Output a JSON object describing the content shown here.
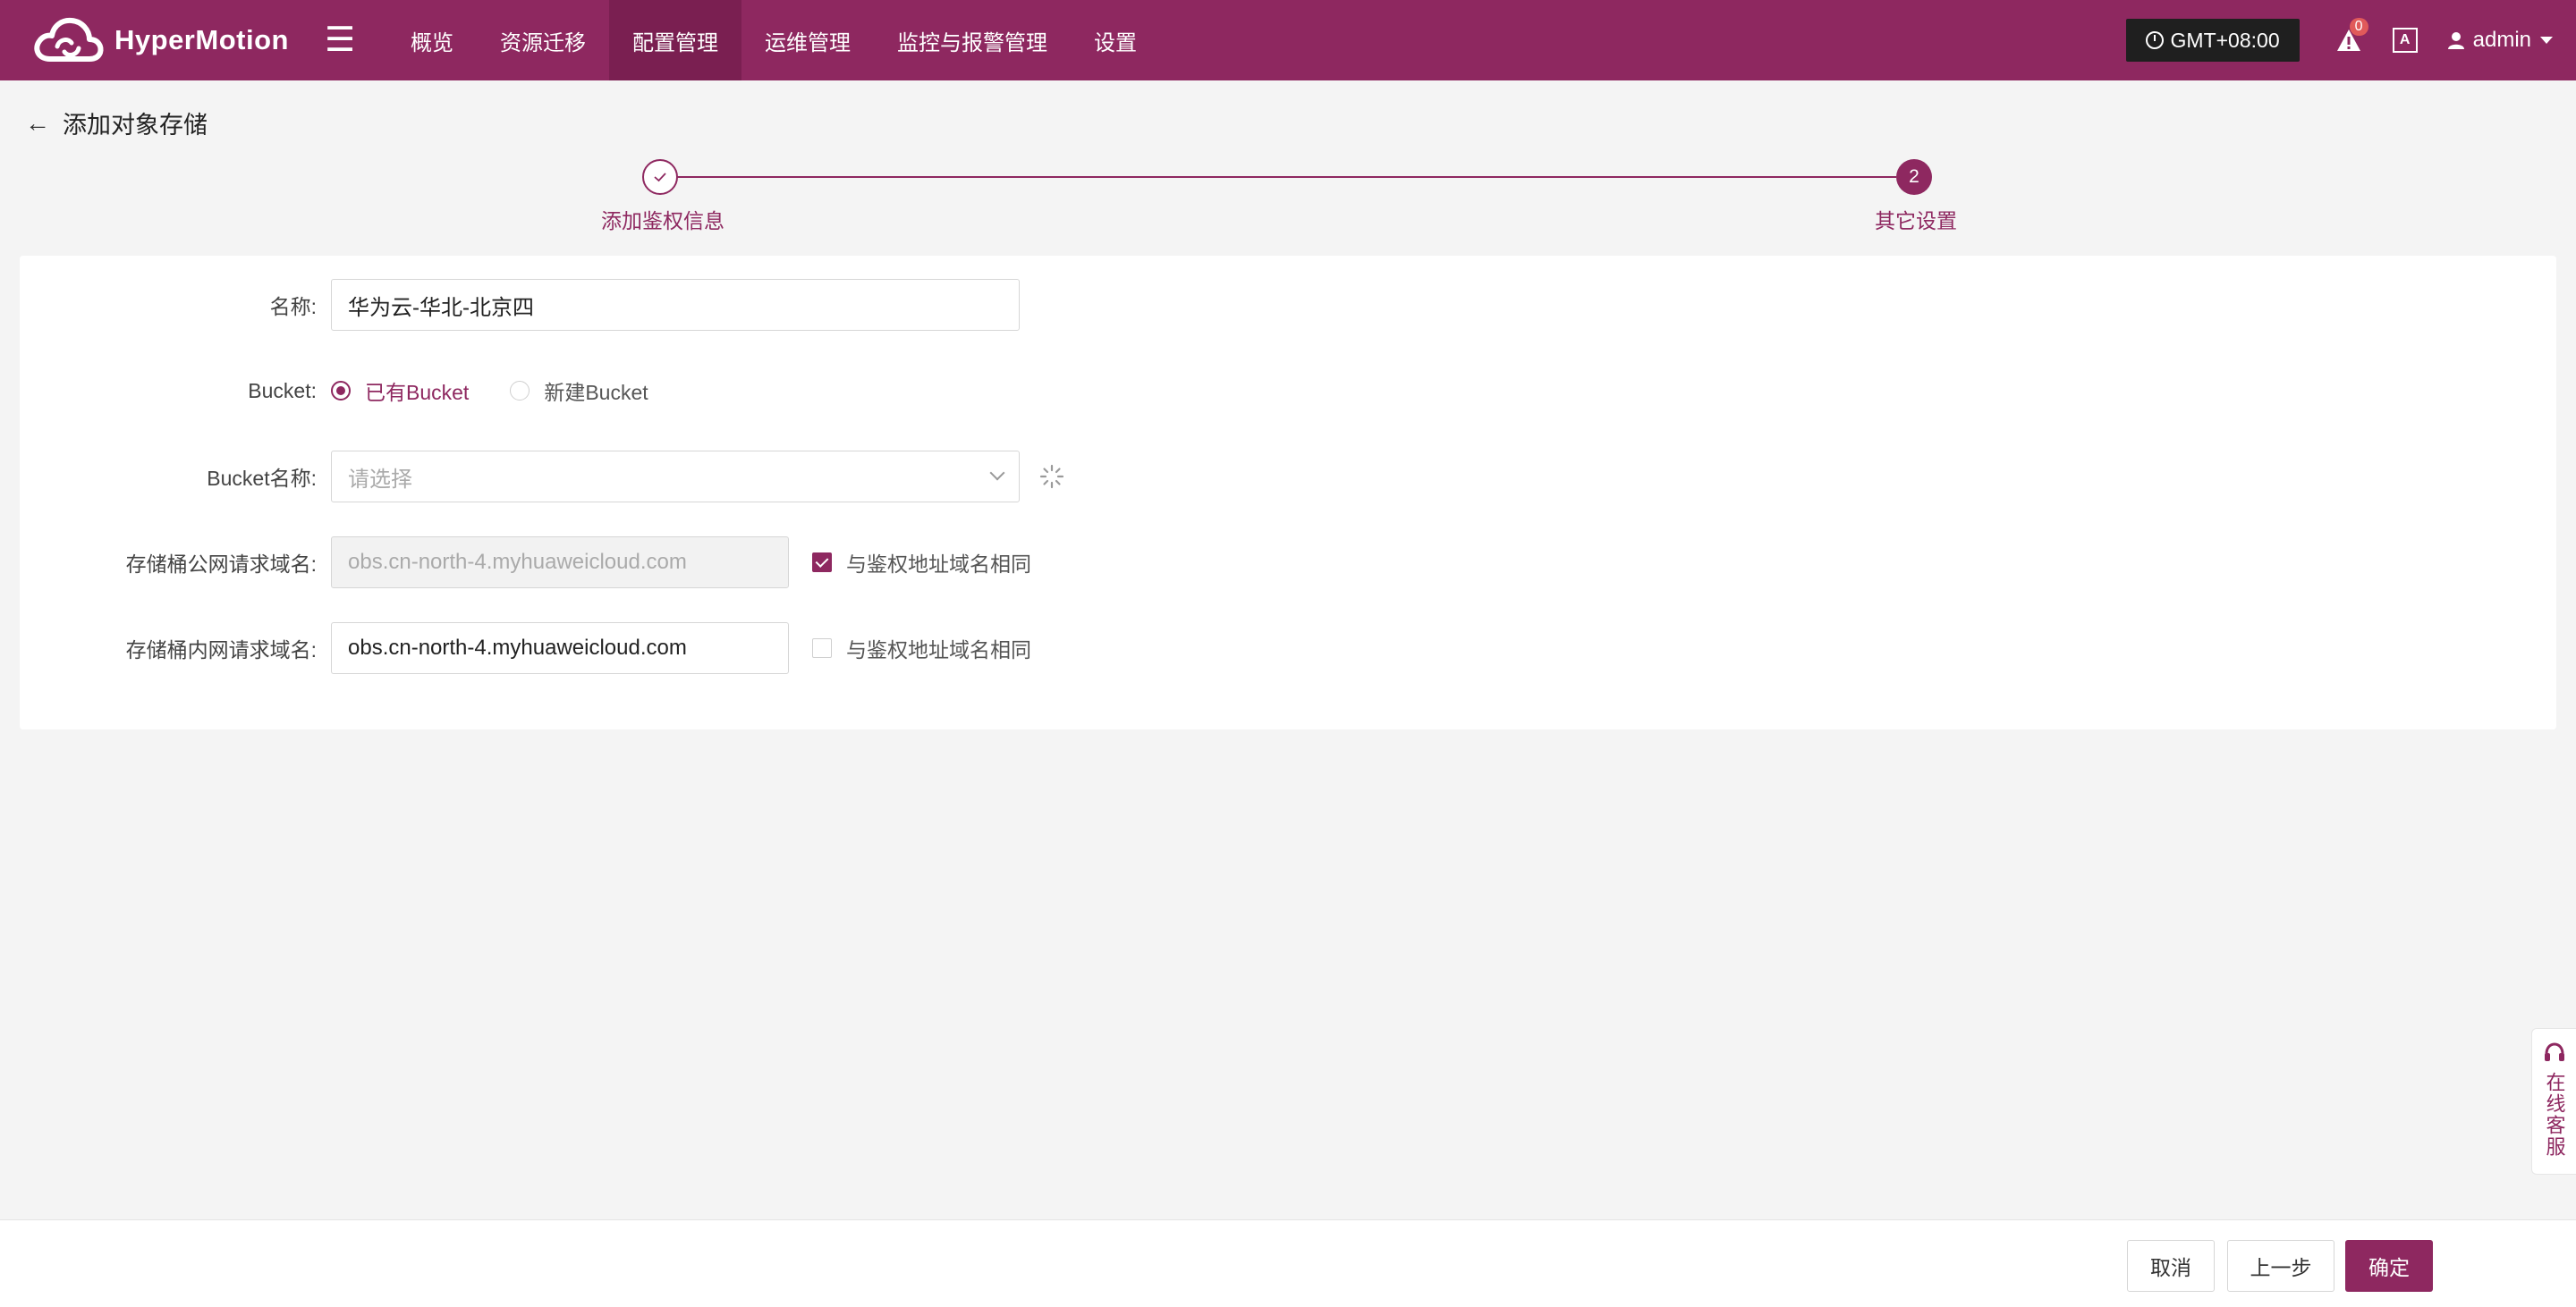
{
  "app": {
    "name": "HyperMotion"
  },
  "nav": {
    "items": [
      {
        "label": "概览",
        "active": false
      },
      {
        "label": "资源迁移",
        "active": false
      },
      {
        "label": "配置管理",
        "active": true
      },
      {
        "label": "运维管理",
        "active": false
      },
      {
        "label": "监控与报警管理",
        "active": false
      },
      {
        "label": "设置",
        "active": false
      }
    ]
  },
  "header": {
    "timezone": "GMT+08:00",
    "alert_count": "0",
    "user": "admin"
  },
  "page": {
    "title": "添加对象存储"
  },
  "steps": [
    {
      "number": "1",
      "label": "添加鉴权信息",
      "state": "done"
    },
    {
      "number": "2",
      "label": "其它设置",
      "state": "current"
    }
  ],
  "form": {
    "name": {
      "label": "名称:",
      "value": "华为云-华北-北京四"
    },
    "bucket": {
      "label": "Bucket:",
      "options": [
        {
          "label": "已有Bucket",
          "checked": true
        },
        {
          "label": "新建Bucket",
          "checked": false
        }
      ]
    },
    "bucket_name": {
      "label": "Bucket名称:",
      "placeholder": "请选择"
    },
    "public_domain": {
      "label": "存储桶公网请求域名:",
      "value": "obs.cn-north-4.myhuaweicloud.com",
      "disabled": true,
      "same_label": "与鉴权地址域名相同",
      "same_checked": true
    },
    "private_domain": {
      "label": "存储桶内网请求域名:",
      "value": "obs.cn-north-4.myhuaweicloud.com",
      "disabled": false,
      "same_label": "与鉴权地址域名相同",
      "same_checked": false
    }
  },
  "footer": {
    "cancel": "取消",
    "prev": "上一步",
    "confirm": "确定"
  },
  "service": {
    "label": "在线客服"
  },
  "colors": {
    "brand": "#8e2860",
    "brand_dark": "#7a1f51"
  }
}
